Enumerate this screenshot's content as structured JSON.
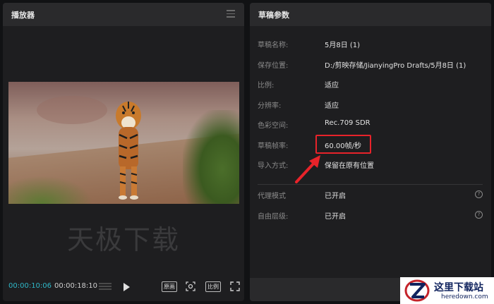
{
  "player": {
    "title": "播放器",
    "watermark": "天极下载",
    "current_time": "00:00:10:06",
    "total_time": "00:00:18:10",
    "original_label": "原画",
    "ratio_label": "比例"
  },
  "draft": {
    "title": "草稿参数",
    "rows": [
      {
        "label": "草稿名称:",
        "value": "5月8日 (1)"
      },
      {
        "label": "保存位置:",
        "value": "D:/剪映存储/JianyingPro Drafts/5月8日 (1)"
      },
      {
        "label": "比例:",
        "value": "适应"
      },
      {
        "label": "分辨率:",
        "value": "适应"
      },
      {
        "label": "色彩空间:",
        "value": "Rec.709 SDR"
      },
      {
        "label": "草稿帧率:",
        "value": "60.00帧/秒"
      },
      {
        "label": "导入方式:",
        "value": "保留在原有位置"
      }
    ],
    "proxy": {
      "label": "代理模式",
      "value": "已开启",
      "help": "?"
    },
    "layer": {
      "label": "自由层级:",
      "value": "已开启",
      "help": "?"
    }
  },
  "badge": {
    "cn": "这里下载站",
    "en": "heredown.com"
  },
  "colors": {
    "accent_time": "#2fb8c8",
    "highlight": "#e8232a"
  }
}
